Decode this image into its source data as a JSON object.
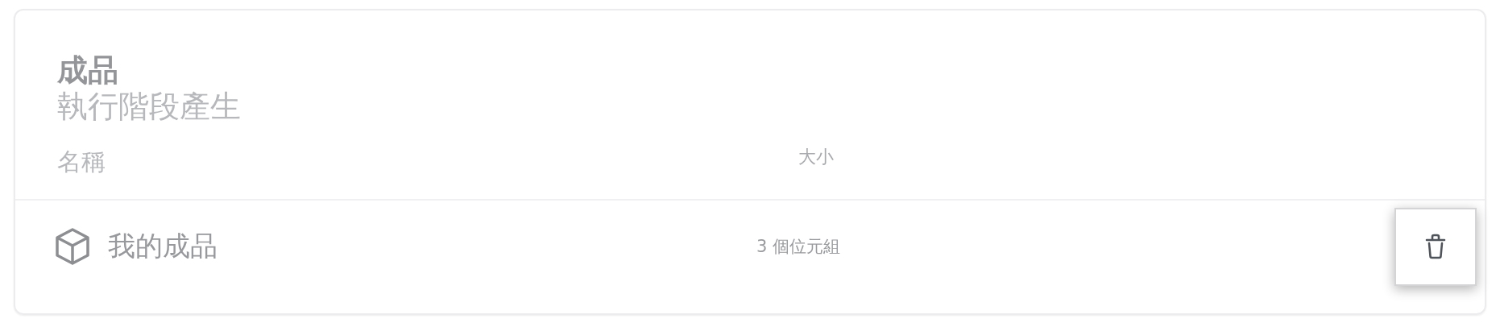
{
  "card": {
    "title": "成品",
    "subtitle": "執行階段產生"
  },
  "table": {
    "columns": [
      "名稱",
      "大小"
    ],
    "rows": [
      {
        "name": "我的成品",
        "size": "3 個位元組"
      }
    ]
  }
}
